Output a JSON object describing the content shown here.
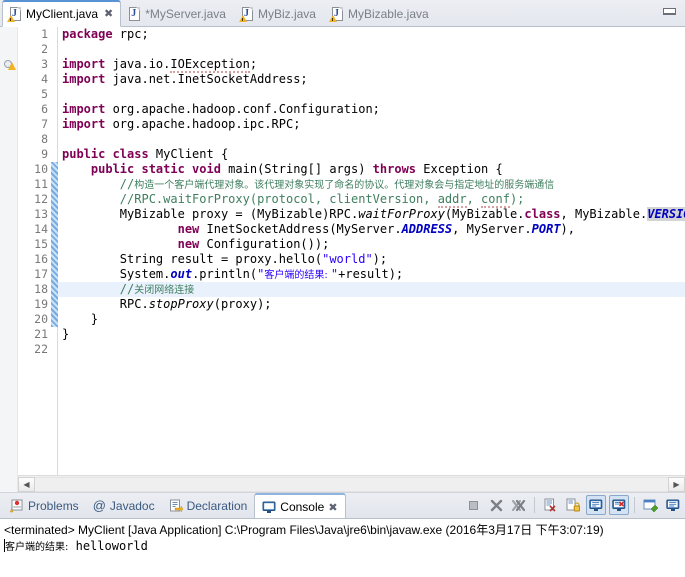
{
  "window": {
    "minimize_label": "Minimize"
  },
  "editor": {
    "tabs": [
      {
        "label": "MyClient.java",
        "active": true,
        "dirty": false,
        "icon": "java-file-icon",
        "closable": true
      },
      {
        "label": "*MyServer.java",
        "active": false,
        "dirty": true,
        "icon": "java-file-icon",
        "closable": false
      },
      {
        "label": "MyBiz.java",
        "active": false,
        "dirty": false,
        "icon": "java-file-icon",
        "closable": false
      },
      {
        "label": "MyBizable.java",
        "active": false,
        "dirty": false,
        "icon": "java-file-icon",
        "closable": false
      }
    ],
    "close_glyph": "✖",
    "highlighted_line": 18,
    "first_line": 1,
    "last_line": 22,
    "lines": [
      {
        "n": 1,
        "text": "package rpc;"
      },
      {
        "n": 2,
        "text": ""
      },
      {
        "n": 3,
        "text": "import java.io.IOException;",
        "fold": true,
        "marker": "warning-marker"
      },
      {
        "n": 4,
        "text": "import java.net.InetSocketAddress;"
      },
      {
        "n": 5,
        "text": ""
      },
      {
        "n": 6,
        "text": "import org.apache.hadoop.conf.Configuration;"
      },
      {
        "n": 7,
        "text": "import org.apache.hadoop.ipc.RPC;"
      },
      {
        "n": 8,
        "text": ""
      },
      {
        "n": 9,
        "text": "public class MyClient {"
      },
      {
        "n": 10,
        "text": "    public static void main(String[] args) throws Exception {",
        "fold": true
      },
      {
        "n": 11,
        "text": "        //构造一个客户端代理对象。该代理对象实现了命名的协议。代理对象会与指定地址的服务端通信"
      },
      {
        "n": 12,
        "text": "        //RPC.waitForProxy(protocol, clientVersion, addr, conf);"
      },
      {
        "n": 13,
        "text": "        MyBizable proxy = (MyBizable)RPC.waitForProxy(MyBizable.class, MyBizable.VERSION,"
      },
      {
        "n": 14,
        "text": "                new InetSocketAddress(MyServer.ADDRESS, MyServer.PORT),"
      },
      {
        "n": 15,
        "text": "                new Configuration());"
      },
      {
        "n": 16,
        "text": "        String result = proxy.hello(\"world\");"
      },
      {
        "n": 17,
        "text": "        System.out.println(\"客户端的结果: \"+result);"
      },
      {
        "n": 18,
        "text": "        //关闭网络连接"
      },
      {
        "n": 19,
        "text": "        RPC.stopProxy(proxy);"
      },
      {
        "n": 20,
        "text": "    }"
      },
      {
        "n": 21,
        "text": "}"
      },
      {
        "n": 22,
        "text": ""
      }
    ],
    "selected_token": "VERSION",
    "scrollbar": {
      "left_arrow": "◀",
      "right_arrow": "▶"
    }
  },
  "bottom_view": {
    "tabs": [
      {
        "label": "Problems",
        "icon": "problems-icon",
        "active": false,
        "closable": false
      },
      {
        "label": "Javadoc",
        "icon": "javadoc-icon",
        "active": false,
        "closable": false
      },
      {
        "label": "Declaration",
        "icon": "declaration-icon",
        "active": false,
        "closable": false
      },
      {
        "label": "Console",
        "icon": "console-icon",
        "active": true,
        "closable": true
      }
    ],
    "close_glyph": "✖",
    "toolbar": [
      {
        "name": "terminate-button",
        "glyph": "■",
        "pressed": false,
        "disabled": true
      },
      {
        "name": "remove-launch-button",
        "glyph": "✖",
        "pressed": false,
        "disabled": false
      },
      {
        "name": "remove-all-launches-button",
        "glyph": "✖",
        "pressed": false,
        "disabled": false
      },
      {
        "name": "separator",
        "glyph": "",
        "pressed": false,
        "disabled": false
      },
      {
        "name": "clear-console-button",
        "glyph": "☰",
        "pressed": false,
        "disabled": false
      },
      {
        "name": "scroll-lock-button",
        "glyph": "⚿",
        "pressed": false,
        "disabled": false
      },
      {
        "name": "show-console-output-button",
        "glyph": "⬜",
        "pressed": true,
        "disabled": false
      },
      {
        "name": "show-console-error-button",
        "glyph": "⬜",
        "pressed": true,
        "disabled": false
      },
      {
        "name": "separator2",
        "glyph": "",
        "pressed": false,
        "disabled": false
      },
      {
        "name": "pin-console-button",
        "glyph": "▣",
        "pressed": false,
        "disabled": false
      },
      {
        "name": "display-selected-console-button",
        "glyph": "▤",
        "pressed": false,
        "disabled": false
      }
    ],
    "console": {
      "status_line": "<terminated> MyClient [Java Application] C:\\Program Files\\Java\\jre6\\bin\\javaw.exe (2016年3月17日 下午3:07:19)",
      "output_prefix_cn": "客户端的结果:",
      "output_value": " helloworld"
    }
  },
  "colors": {
    "keyword": "#7f0055",
    "string": "#2a00ff",
    "comment": "#3f7f5f",
    "static_field": "#0000c0",
    "selection": "#d4d4d4",
    "line_highlight": "#e8f1fc",
    "tab_accent": "#5a93d4"
  }
}
